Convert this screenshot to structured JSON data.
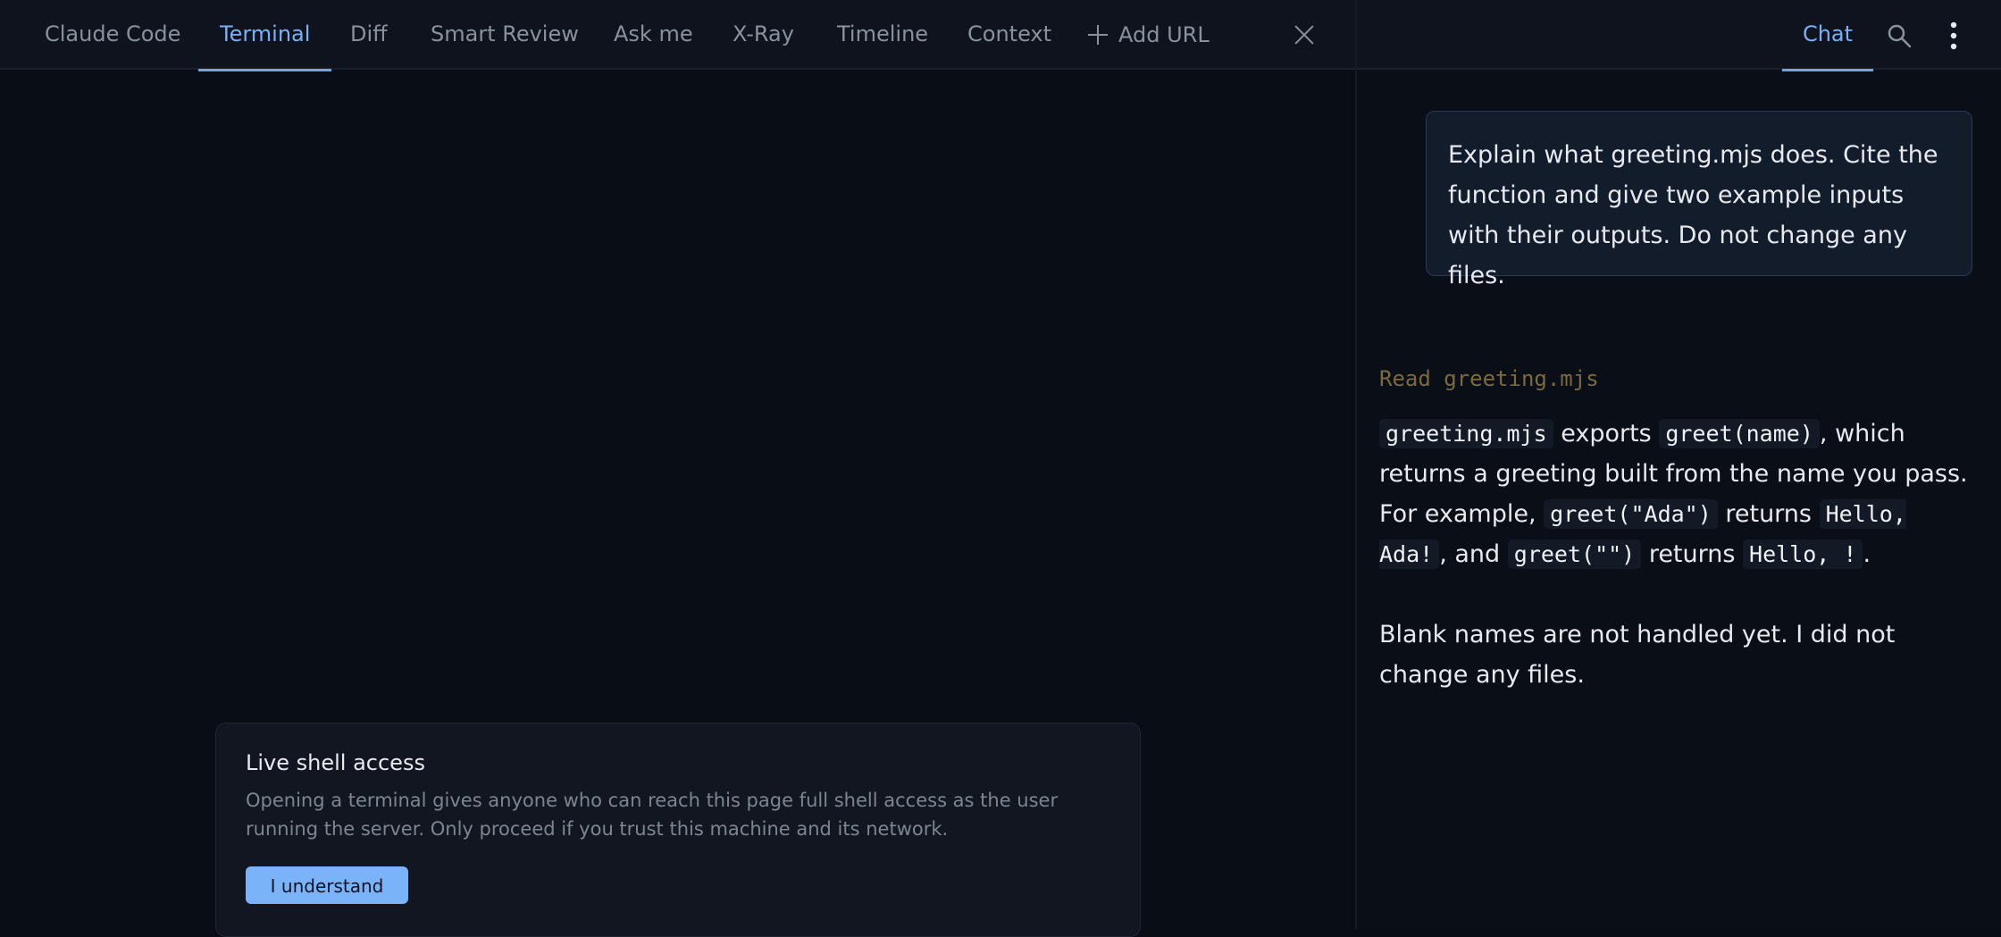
{
  "tabs": [
    {
      "label": "Claude Code",
      "active": false
    },
    {
      "label": "Terminal",
      "active": true
    },
    {
      "label": "Diff",
      "active": false
    },
    {
      "label": "Smart Review",
      "active": false
    },
    {
      "label": "Ask me",
      "active": false
    },
    {
      "label": "X-Ray",
      "active": false
    },
    {
      "label": "Timeline",
      "active": false
    },
    {
      "label": "Context",
      "active": false
    }
  ],
  "add_url_label": "Add URL",
  "notice": {
    "title": "Live shell access",
    "body": "Opening a terminal gives anyone who can reach this page full shell access as the user running the server. Only proceed if you trust this machine and its network.",
    "button": "I understand"
  },
  "right_header": {
    "chat_tab": "Chat"
  },
  "chat": {
    "user_message": "Explain what greeting.mjs does. Cite the function and give two example inputs with their outputs. Do not change any files.",
    "tool_line": "Read greeting.mjs",
    "reply_p1": {
      "code1": "greeting.mjs",
      "t1": " exports ",
      "code2": "greet(name)",
      "t2": ", which returns a greeting built from the name you pass. For example, ",
      "code3": "greet(\"Ada\")",
      "t3": " returns ",
      "code4": "Hello, Ada!",
      "t4": ", and ",
      "code5": "greet(\"\")",
      "t5": " returns ",
      "code6": "Hello, !",
      "t6": "."
    },
    "reply_p2": "Blank names are not handled yet. I did not change any files."
  },
  "colors": {
    "accent": "#7ab0f5",
    "background": "#090d16",
    "button": "#7ab3f7"
  }
}
